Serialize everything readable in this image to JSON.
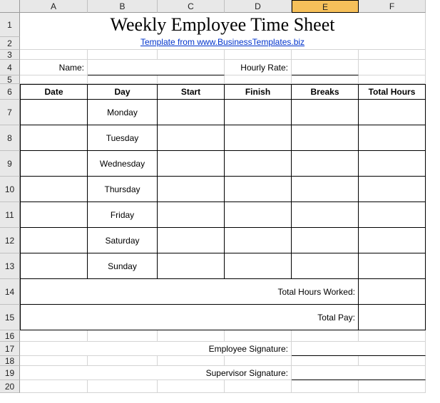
{
  "columns": [
    "A",
    "B",
    "C",
    "D",
    "E",
    "F"
  ],
  "rows": [
    "1",
    "2",
    "3",
    "4",
    "5",
    "6",
    "7",
    "8",
    "9",
    "10",
    "11",
    "12",
    "13",
    "14",
    "15",
    "16",
    "17",
    "18",
    "19",
    "20"
  ],
  "selected_column": "E",
  "title": "Weekly Employee Time Sheet",
  "subtitle_link": "Template from www.BusinessTemplates.biz",
  "labels": {
    "name": "Name:",
    "hourly_rate": "Hourly Rate:",
    "total_hours_worked": "Total Hours Worked:",
    "total_pay": "Total Pay:",
    "employee_signature": "Employee Signature:",
    "supervisor_signature": "Supervisor Signature:"
  },
  "headers": {
    "date": "Date",
    "day": "Day",
    "start": "Start",
    "finish": "Finish",
    "breaks": "Breaks",
    "total_hours": "Total Hours"
  },
  "days": [
    "Monday",
    "Tuesday",
    "Wednesday",
    "Thursday",
    "Friday",
    "Saturday",
    "Sunday"
  ],
  "values": {
    "name": "",
    "hourly_rate": "",
    "total_hours_worked": "",
    "total_pay": "",
    "employee_signature": "",
    "supervisor_signature": ""
  },
  "entries": [
    {
      "date": "",
      "start": "",
      "finish": "",
      "breaks": "",
      "total": ""
    },
    {
      "date": "",
      "start": "",
      "finish": "",
      "breaks": "",
      "total": ""
    },
    {
      "date": "",
      "start": "",
      "finish": "",
      "breaks": "",
      "total": ""
    },
    {
      "date": "",
      "start": "",
      "finish": "",
      "breaks": "",
      "total": ""
    },
    {
      "date": "",
      "start": "",
      "finish": "",
      "breaks": "",
      "total": ""
    },
    {
      "date": "",
      "start": "",
      "finish": "",
      "breaks": "",
      "total": ""
    },
    {
      "date": "",
      "start": "",
      "finish": "",
      "breaks": "",
      "total": ""
    }
  ]
}
